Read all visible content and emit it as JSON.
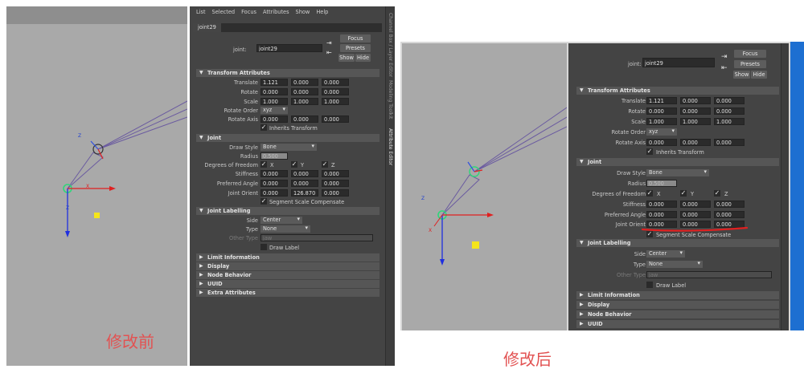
{
  "menu": [
    "List",
    "Selected",
    "Focus",
    "Attributes",
    "Show",
    "Help"
  ],
  "node_tab": "joint29",
  "joint_label": "joint:",
  "joint_name": "joint29",
  "buttons": {
    "focus": "Focus",
    "presets": "Presets",
    "show": "Show",
    "hide": "Hide"
  },
  "side_tabs": [
    "Channel Box / Layer Editor",
    "Modeling Toolkit",
    "Attribute Editor"
  ],
  "sections": {
    "transform": "Transform Attributes",
    "joint": "Joint",
    "labelling": "Joint Labelling",
    "limit": "Limit Information",
    "display": "Display",
    "node": "Node Behavior",
    "uuid": "UUID",
    "extra": "Extra Attributes"
  },
  "labels": {
    "translate": "Translate",
    "rotate": "Rotate",
    "scale": "Scale",
    "rotate_order": "Rotate Order",
    "rotate_axis": "Rotate Axis",
    "inherits": "Inherits Transform",
    "draw_style": "Draw Style",
    "radius": "Radius",
    "dof": "Degrees of Freedom",
    "stiffness": "Stiffness",
    "preferred": "Preferred Angle",
    "joint_orient": "Joint Orient",
    "ssc": "Segment Scale Compensate",
    "side": "Side",
    "type": "Type",
    "other_type": "Other Type",
    "draw_label": "Draw Label",
    "dof_x": "X",
    "dof_y": "Y",
    "dof_z": "Z"
  },
  "before": {
    "translate": [
      "1.121",
      "0.000",
      "0.000"
    ],
    "rotate": [
      "0.000",
      "0.000",
      "0.000"
    ],
    "scale": [
      "1.000",
      "1.000",
      "1.000"
    ],
    "rotate_order": "xyz",
    "rotate_axis": [
      "0.000",
      "0.000",
      "0.000"
    ],
    "draw_style": "Bone",
    "radius": "0.500",
    "stiffness": [
      "0.000",
      "0.000",
      "0.000"
    ],
    "preferred": [
      "0.000",
      "0.000",
      "0.000"
    ],
    "joint_orient": [
      "0.000",
      "126.870",
      "0.000"
    ],
    "side": "Center",
    "type": "None",
    "other_type": "jaw"
  },
  "after": {
    "translate": [
      "1.121",
      "0.000",
      "0.000"
    ],
    "rotate": [
      "0.000",
      "0.000",
      "0.000"
    ],
    "scale": [
      "1.000",
      "1.000",
      "1.000"
    ],
    "rotate_order": "xyz",
    "rotate_axis": [
      "0.000",
      "0.000",
      "0.000"
    ],
    "draw_style": "Bone",
    "radius": "0.500",
    "stiffness": [
      "0.000",
      "0.000",
      "0.000"
    ],
    "preferred": [
      "0.000",
      "0.000",
      "0.000"
    ],
    "joint_orient": [
      "0.000",
      "0.000",
      "0.000"
    ],
    "side": "Center",
    "type": "None",
    "other_type": "jaw"
  },
  "captions": {
    "before": "修改前",
    "after": "修改后"
  },
  "axis_labels": {
    "x": "X",
    "y": "Y",
    "z": "Z"
  },
  "colors": {
    "viewport": "#a9a9a9",
    "panel": "#444444",
    "annotation": "#e02020",
    "joint": "#2fd67a"
  }
}
